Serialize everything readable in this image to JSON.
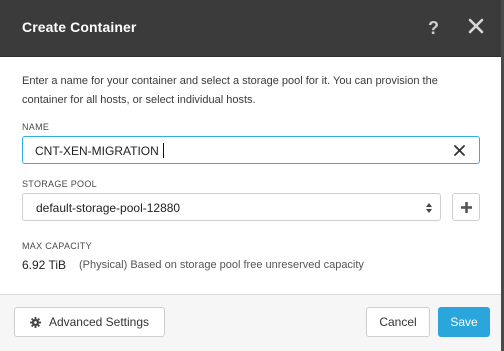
{
  "dialog": {
    "title": "Create Container",
    "help_label": "?"
  },
  "intro_text": "Enter a name for your container and select a storage pool for it. You can provision the container for all hosts, or select individual hosts.",
  "name_field": {
    "label": "NAME",
    "value": "CNT-XEN-MIGRATION"
  },
  "storage_pool": {
    "label": "STORAGE POOL",
    "selected": "default-storage-pool-12880"
  },
  "max_capacity": {
    "label": "MAX CAPACITY",
    "value": "6.92 TiB",
    "description": "(Physical) Based on storage pool free unreserved capacity"
  },
  "footer": {
    "advanced_label": "Advanced Settings",
    "cancel_label": "Cancel",
    "save_label": "Save"
  },
  "colors": {
    "header_bg": "#3b3b3b",
    "accent": "#2aa6dc",
    "focus_border": "#30aee3"
  },
  "icons": [
    "help-icon",
    "close-icon",
    "clear-icon",
    "select-arrows-icon",
    "plus-icon",
    "gear-icon"
  ]
}
